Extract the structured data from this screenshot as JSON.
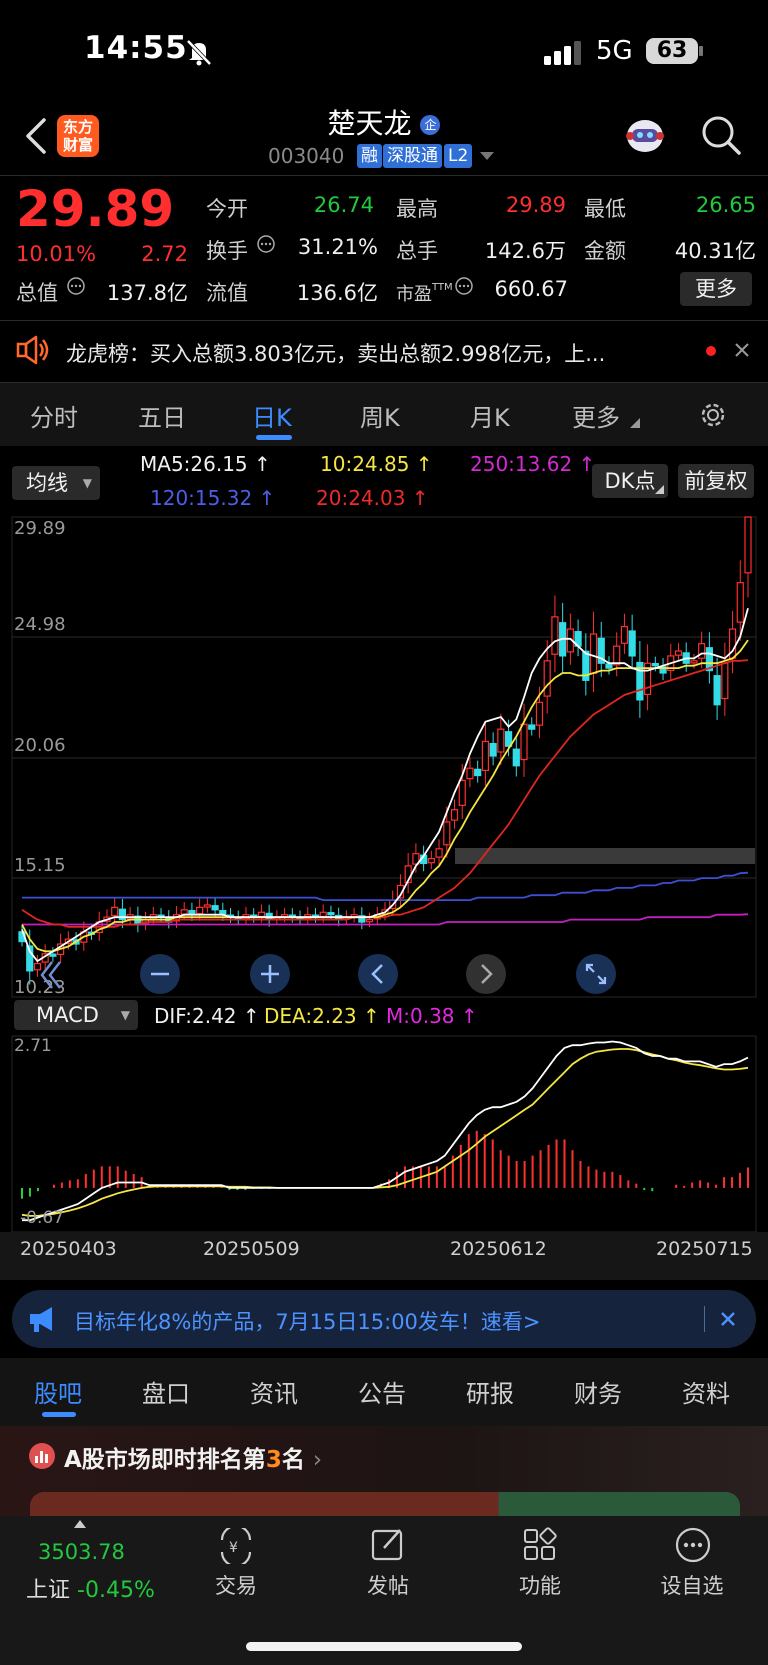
{
  "status_bar": {
    "time": "14:55",
    "network": "5G",
    "battery": "63"
  },
  "header": {
    "logo_line1": "东方",
    "logo_line2": "财富",
    "name": "楚天龙",
    "name_badge": "企",
    "code": "003040",
    "tags": [
      "融",
      "深股通",
      "L2"
    ]
  },
  "quote": {
    "price": "29.89",
    "change_pct": "10.01%",
    "change": "2.72",
    "open_label": "今开",
    "open": "26.74",
    "high_label": "最高",
    "high": "29.89",
    "low_label": "最低",
    "low": "26.65",
    "turnover_label": "换手",
    "turnover": "31.21%",
    "volume_label": "总手",
    "volume": "142.6万",
    "amount_label": "金额",
    "amount": "40.31亿",
    "mcap_label": "总值",
    "mcap": "137.8亿",
    "float_label": "流值",
    "float_mcap": "136.6亿",
    "pe_label": "市盈",
    "pe_sup": "TTM",
    "pe": "660.67",
    "more_button": "更多"
  },
  "notice": {
    "text": "龙虎榜：买入总额3.803亿元，卖出总额2.998亿元，上..."
  },
  "kline_tabs": {
    "items": [
      "分时",
      "五日",
      "日K",
      "周K",
      "月K",
      "更多"
    ],
    "active": "日K"
  },
  "indicators": {
    "selector": "均线",
    "ma5": "MA5:26.15",
    "ma10": "10:24.85",
    "ma250": "250:13.62",
    "ma120": "120:15.32",
    "ma20": "20:24.03",
    "dk_button": "DK点",
    "adjust_button": "前复权"
  },
  "macd": {
    "selector": "MACD",
    "dif": "DIF:2.42",
    "dea": "DEA:2.23",
    "m": "M:0.38",
    "top_label": "2.71",
    "bottom_label": "-0.67"
  },
  "chart_data": {
    "type": "candlestick",
    "y_ticks": [
      "29.89",
      "24.98",
      "20.06",
      "15.15",
      "10.23"
    ],
    "ylim": [
      10.23,
      29.89
    ],
    "x_ticks": [
      "20250403",
      "20250509",
      "20250612",
      "20250715"
    ],
    "colors": {
      "up": "#ff3030",
      "down": "#33dde8",
      "ma5": "#ffffff",
      "ma10": "#f5e642",
      "ma20": "#e0261f",
      "ma120": "#3d4fd6",
      "ma250": "#c51fc2"
    },
    "close": [
      12.5,
      11.3,
      11.6,
      12.0,
      11.9,
      12.4,
      12.6,
      12.4,
      12.9,
      12.8,
      13.3,
      13.5,
      13.9,
      13.4,
      13.6,
      13.2,
      13.4,
      13.6,
      13.5,
      13.3,
      13.6,
      13.8,
      13.6,
      13.9,
      14.0,
      13.8,
      13.6,
      13.5,
      13.4,
      13.6,
      13.5,
      13.7,
      13.4,
      13.5,
      13.6,
      13.5,
      13.4,
      13.6,
      13.5,
      13.7,
      13.6,
      13.4,
      13.5,
      13.6,
      13.3,
      13.4,
      13.6,
      13.8,
      14.2,
      14.8,
      15.6,
      16.1,
      15.7,
      15.9,
      16.3,
      17.4,
      17.9,
      19.1,
      19.6,
      19.3,
      20.7,
      20.1,
      21.2,
      20.5,
      19.7,
      21.4,
      21.2,
      22.3,
      24.0,
      25.8,
      24.2,
      25.3,
      24.6,
      23.2,
      25.1,
      23.9,
      23.7,
      24.6,
      25.4,
      24.2,
      22.4,
      23.9,
      23.8,
      23.5,
      24.2,
      24.4,
      23.9,
      24.0,
      24.7,
      23.6,
      22.2,
      23.9,
      25.3,
      27.2,
      29.89
    ],
    "ma5": [
      13.0,
      12.1,
      11.7,
      11.9,
      12.1,
      12.3,
      12.5,
      12.7,
      12.9,
      13.1,
      13.3,
      13.4,
      13.5,
      13.5,
      13.5,
      13.5,
      13.5,
      13.5,
      13.5,
      13.5,
      13.5,
      13.6,
      13.6,
      13.6,
      13.6,
      13.6,
      13.6,
      13.5,
      13.5,
      13.5,
      13.5,
      13.5,
      13.5,
      13.5,
      13.5,
      13.5,
      13.5,
      13.5,
      13.5,
      13.5,
      13.5,
      13.5,
      13.5,
      13.5,
      13.5,
      13.5,
      13.6,
      13.7,
      14.0,
      14.4,
      15.0,
      15.6,
      16.0,
      16.5,
      17.0,
      17.8,
      18.6,
      19.3,
      20.2,
      20.9,
      21.5,
      21.6,
      21.7,
      21.3,
      21.6,
      22.5,
      23.5,
      24.1,
      24.5,
      24.8,
      24.9,
      24.9,
      24.6,
      24.3,
      24.2,
      24.1,
      23.9,
      23.9,
      23.9,
      23.7,
      23.6,
      23.6,
      23.7,
      23.8,
      23.9,
      24.0,
      24.1,
      24.1,
      24.3,
      24.3,
      24.2,
      24.1,
      24.4,
      25.0,
      26.15
    ],
    "ma10": [
      13.2,
      12.6,
      12.2,
      12.1,
      12.1,
      12.2,
      12.3,
      12.5,
      12.7,
      12.8,
      13.0,
      13.1,
      13.3,
      13.3,
      13.4,
      13.4,
      13.4,
      13.4,
      13.4,
      13.4,
      13.5,
      13.5,
      13.5,
      13.5,
      13.5,
      13.5,
      13.5,
      13.5,
      13.5,
      13.5,
      13.5,
      13.5,
      13.5,
      13.5,
      13.5,
      13.5,
      13.5,
      13.5,
      13.5,
      13.5,
      13.5,
      13.5,
      13.5,
      13.5,
      13.5,
      13.5,
      13.5,
      13.6,
      13.7,
      13.9,
      14.2,
      14.6,
      14.9,
      15.3,
      15.6,
      16.1,
      16.7,
      17.2,
      17.8,
      18.3,
      18.8,
      19.3,
      19.9,
      20.4,
      20.9,
      21.5,
      22.1,
      22.6,
      23.0,
      23.3,
      23.5,
      23.5,
      23.4,
      23.4,
      23.5,
      23.6,
      23.6,
      23.7,
      23.7,
      23.7,
      23.7,
      23.7,
      23.7,
      23.7,
      23.7,
      23.7,
      23.8,
      23.8,
      23.9,
      23.9,
      23.9,
      24.0,
      24.1,
      24.4,
      24.85
    ],
    "ma20": [
      13.8,
      13.6,
      13.4,
      13.3,
      13.2,
      13.2,
      13.1,
      13.1,
      13.1,
      13.1,
      13.1,
      13.1,
      13.1,
      13.2,
      13.2,
      13.2,
      13.3,
      13.3,
      13.3,
      13.3,
      13.4,
      13.4,
      13.4,
      13.4,
      13.4,
      13.4,
      13.4,
      13.4,
      13.4,
      13.4,
      13.4,
      13.4,
      13.4,
      13.4,
      13.4,
      13.4,
      13.4,
      13.4,
      13.4,
      13.4,
      13.4,
      13.4,
      13.4,
      13.5,
      13.5,
      13.5,
      13.5,
      13.5,
      13.6,
      13.6,
      13.7,
      13.8,
      13.9,
      14.1,
      14.3,
      14.5,
      14.7,
      15.0,
      15.3,
      15.7,
      16.1,
      16.5,
      16.9,
      17.3,
      17.8,
      18.3,
      18.8,
      19.3,
      19.7,
      20.1,
      20.5,
      20.9,
      21.2,
      21.5,
      21.8,
      22.0,
      22.2,
      22.4,
      22.6,
      22.7,
      22.8,
      22.9,
      23.0,
      23.1,
      23.2,
      23.3,
      23.4,
      23.5,
      23.6,
      23.7,
      23.8,
      23.9,
      24.0,
      24.0,
      24.03
    ],
    "ma120": [
      14.3,
      14.3,
      14.3,
      14.3,
      14.3,
      14.3,
      14.3,
      14.3,
      14.3,
      14.3,
      14.3,
      14.3,
      14.3,
      14.3,
      14.3,
      14.3,
      14.3,
      14.3,
      14.3,
      14.3,
      14.3,
      14.3,
      14.3,
      14.3,
      14.3,
      14.3,
      14.3,
      14.3,
      14.3,
      14.3,
      14.3,
      14.3,
      14.3,
      14.3,
      14.3,
      14.3,
      14.3,
      14.3,
      14.3,
      14.2,
      14.2,
      14.2,
      14.2,
      14.2,
      14.2,
      14.2,
      14.2,
      14.2,
      14.2,
      14.2,
      14.2,
      14.2,
      14.2,
      14.2,
      14.2,
      14.2,
      14.2,
      14.2,
      14.2,
      14.3,
      14.3,
      14.3,
      14.3,
      14.3,
      14.3,
      14.3,
      14.4,
      14.4,
      14.4,
      14.4,
      14.5,
      14.5,
      14.5,
      14.5,
      14.6,
      14.6,
      14.6,
      14.7,
      14.7,
      14.7,
      14.8,
      14.8,
      14.8,
      14.9,
      14.9,
      15.0,
      15.0,
      15.0,
      15.1,
      15.1,
      15.1,
      15.2,
      15.2,
      15.3,
      15.32
    ],
    "ma250": [
      13.2,
      13.2,
      13.2,
      13.2,
      13.2,
      13.2,
      13.2,
      13.2,
      13.2,
      13.2,
      13.2,
      13.2,
      13.2,
      13.2,
      13.2,
      13.2,
      13.2,
      13.2,
      13.2,
      13.2,
      13.2,
      13.2,
      13.2,
      13.2,
      13.2,
      13.2,
      13.2,
      13.2,
      13.2,
      13.2,
      13.2,
      13.2,
      13.2,
      13.2,
      13.2,
      13.2,
      13.2,
      13.2,
      13.2,
      13.2,
      13.2,
      13.2,
      13.2,
      13.2,
      13.2,
      13.2,
      13.2,
      13.2,
      13.2,
      13.2,
      13.2,
      13.2,
      13.2,
      13.2,
      13.2,
      13.3,
      13.3,
      13.3,
      13.3,
      13.3,
      13.3,
      13.3,
      13.3,
      13.3,
      13.3,
      13.3,
      13.3,
      13.3,
      13.3,
      13.3,
      13.3,
      13.4,
      13.4,
      13.4,
      13.4,
      13.4,
      13.4,
      13.4,
      13.4,
      13.4,
      13.4,
      13.5,
      13.5,
      13.5,
      13.5,
      13.5,
      13.5,
      13.5,
      13.5,
      13.5,
      13.6,
      13.6,
      13.6,
      13.6,
      13.62
    ],
    "macd_dif": [
      -0.6,
      -0.6,
      -0.55,
      -0.5,
      -0.45,
      -0.4,
      -0.35,
      -0.3,
      -0.2,
      -0.1,
      0.0,
      0.05,
      0.1,
      0.1,
      0.1,
      0.1,
      0.05,
      0.05,
      0.05,
      0.05,
      0.05,
      0.05,
      0.05,
      0.05,
      0.05,
      0.05,
      0.0,
      0.0,
      0.0,
      0.0,
      0.0,
      0.0,
      0.0,
      0.0,
      0.0,
      0.0,
      0.0,
      0.0,
      0.0,
      0.0,
      0.0,
      0.0,
      0.0,
      0.0,
      0.0,
      0.05,
      0.1,
      0.2,
      0.3,
      0.35,
      0.4,
      0.45,
      0.5,
      0.6,
      0.8,
      1.0,
      1.2,
      1.35,
      1.45,
      1.5,
      1.5,
      1.55,
      1.6,
      1.7,
      1.85,
      2.05,
      2.25,
      2.45,
      2.6,
      2.65,
      2.65,
      2.68,
      2.7,
      2.7,
      2.72,
      2.7,
      2.65,
      2.6,
      2.5,
      2.45,
      2.45,
      2.4,
      2.4,
      2.35,
      2.35,
      2.35,
      2.3,
      2.25,
      2.3,
      2.3,
      2.35,
      2.42
    ],
    "macd_dea": [
      -0.5,
      -0.52,
      -0.52,
      -0.5,
      -0.48,
      -0.45,
      -0.42,
      -0.38,
      -0.33,
      -0.27,
      -0.2,
      -0.15,
      -0.1,
      -0.06,
      -0.03,
      0.0,
      0.02,
      0.03,
      0.03,
      0.03,
      0.03,
      0.03,
      0.03,
      0.03,
      0.03,
      0.03,
      0.02,
      0.02,
      0.02,
      0.01,
      0.01,
      0.01,
      0.0,
      0.0,
      0.0,
      0.0,
      0.0,
      0.0,
      0.0,
      0.0,
      0.0,
      0.0,
      0.0,
      0.0,
      0.0,
      0.01,
      0.02,
      0.05,
      0.1,
      0.15,
      0.2,
      0.25,
      0.3,
      0.4,
      0.5,
      0.6,
      0.7,
      0.82,
      0.95,
      1.05,
      1.15,
      1.25,
      1.35,
      1.45,
      1.55,
      1.7,
      1.85,
      2.0,
      2.15,
      2.3,
      2.4,
      2.48,
      2.53,
      2.55,
      2.57,
      2.58,
      2.58,
      2.56,
      2.52,
      2.48,
      2.45,
      2.4,
      2.37,
      2.33,
      2.3,
      2.28,
      2.25,
      2.22,
      2.2,
      2.2,
      2.21,
      2.23
    ]
  },
  "promo": {
    "text": "目标年化8%的产品，7月15日15:00发车！速看>"
  },
  "bottom_tabs": {
    "items": [
      "股吧",
      "盘口",
      "资讯",
      "公告",
      "研报",
      "财务",
      "资料"
    ],
    "active": "股吧"
  },
  "ranking": {
    "prefix": "A股市场即时排名第",
    "rank": "3",
    "suffix": "名"
  },
  "index": {
    "value": "3503.78",
    "name": "上证",
    "change": "-0.45%"
  },
  "nav": {
    "trade": "交易",
    "post": "发帖",
    "function": "功能",
    "watchlist": "设自选"
  }
}
